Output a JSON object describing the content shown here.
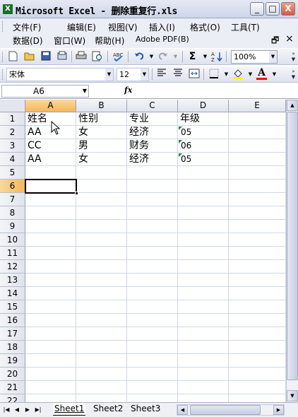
{
  "window": {
    "title": "Microsoft Excel - 删除重复行.xls",
    "controls": {
      "minimize": "_",
      "restore": "□",
      "close": "X"
    }
  },
  "menu": {
    "items_row1": [
      "文件(F)",
      "编辑(E)",
      "视图(V)",
      "插入(I)",
      "格式(O)",
      "工具(T)"
    ],
    "items_row2": [
      "数据(D)",
      "窗口(W)",
      "帮助(H)",
      "Adobe PDF(B)"
    ],
    "doc_restore": "🗗",
    "doc_close": "×"
  },
  "standard_toolbar": {
    "zoom": "100%",
    "autosum": "Σ"
  },
  "format_toolbar": {
    "font_name": "宋体",
    "font_size": "12",
    "font_color_letter": "A",
    "fill_color": "#ffff00",
    "font_color": "#ff0000"
  },
  "formula_bar": {
    "name_box": "A6",
    "fx_label": "fx",
    "formula": ""
  },
  "sheet": {
    "columns": [
      "A",
      "B",
      "C",
      "D",
      "E"
    ],
    "active_column": "A",
    "rows": [
      "1",
      "2",
      "3",
      "4",
      "5",
      "6",
      "7",
      "8",
      "9",
      "10",
      "11",
      "12",
      "13",
      "14",
      "15",
      "16",
      "17",
      "18",
      "19",
      "20",
      "21",
      "22"
    ],
    "active_row": "6",
    "data": [
      [
        "姓名",
        "性别",
        "专业",
        "年级"
      ],
      [
        "AA",
        "女",
        "经济",
        "05"
      ],
      [
        "CC",
        "男",
        "财务",
        "06"
      ],
      [
        "AA",
        "女",
        "经济",
        "05"
      ]
    ]
  },
  "tabs": {
    "sheets": [
      "Sheet1",
      "Sheet2",
      "Sheet3"
    ],
    "active": "Sheet1"
  },
  "colors": {
    "header_active": "#f5b65a",
    "error_indicator": "#1f8a2b"
  }
}
